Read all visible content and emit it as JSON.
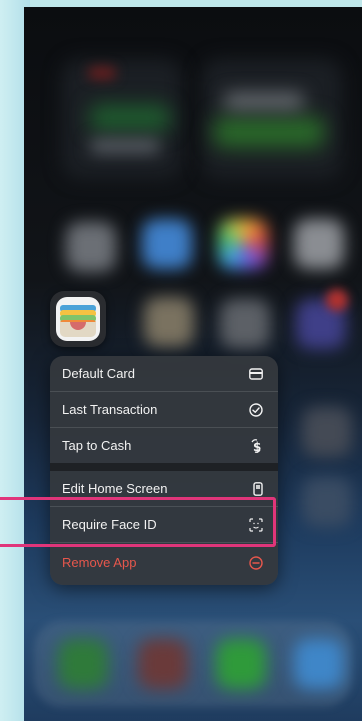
{
  "menu": {
    "items": [
      {
        "label": "Default Card",
        "icon": "card-icon"
      },
      {
        "label": "Last Transaction",
        "icon": "checkmark-circle-icon"
      },
      {
        "label": "Tap to Cash",
        "icon": "tap-to-cash-icon"
      },
      {
        "label": "Edit Home Screen",
        "icon": "phone-icon"
      },
      {
        "label": "Require Face ID",
        "icon": "face-id-icon"
      },
      {
        "label": "Remove App",
        "icon": "minus-circle-icon"
      }
    ]
  },
  "app": {
    "name": "Wallet",
    "icon": "wallet-icon"
  },
  "colors": {
    "highlight": "#e0357a",
    "danger": "#e6574c",
    "menu_bg": "#34383e"
  }
}
